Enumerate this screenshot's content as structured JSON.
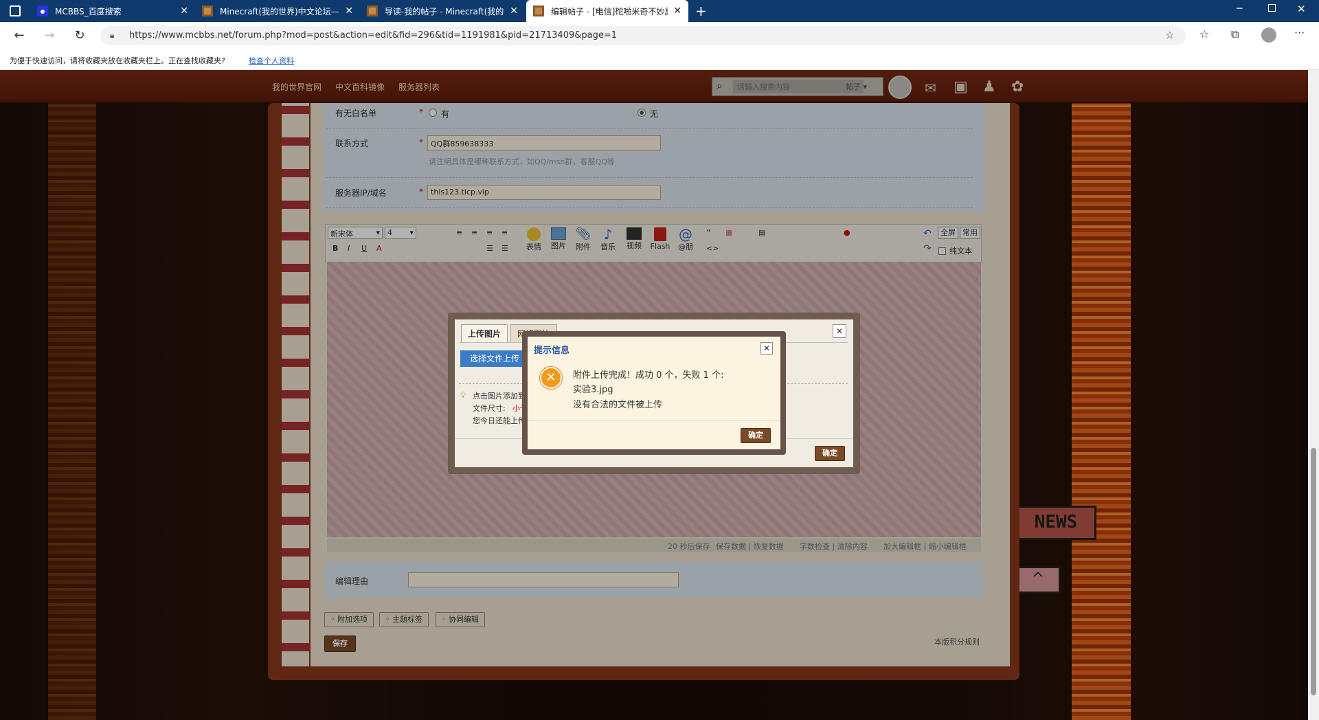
{
  "browser": {
    "tabs": [
      {
        "label": "MCBBS_百度搜索",
        "icon": "baidu-icon"
      },
      {
        "label": "Minecraft(我的世界)中文论坛—",
        "icon": "mcbbs-icon"
      },
      {
        "label": "导读-我的帖子 - Minecraft(我的世",
        "icon": "mcbbs-icon"
      },
      {
        "label": "编辑帖子 - [电信]砣啪米奇不妙屋",
        "icon": "mcbbs-icon"
      }
    ],
    "url": "https://www.mcbbs.net/forum.php?mod=post&action=edit&fid=296&tid=1191981&pid=21713409&page=1",
    "favbar_text": "为便于快速访问，请将收藏夹放在收藏夹栏上。正在查找收藏夹?",
    "favbar_link": "检查个人资料"
  },
  "sitenav": {
    "links": [
      "我的世界官网",
      "中文百科镜像",
      "服务器列表"
    ],
    "search_placeholder": "请输入搜索内容",
    "search_type": "帖子"
  },
  "form": {
    "whitelist_label": "有无白名单",
    "opt_yes": "有",
    "opt_no": "无",
    "contact_label": "联系方式",
    "contact_value": "QQ群859638333",
    "contact_hint": "请注明具体是哪种联系方式，如QQ/msn群，客服QQ等",
    "ip_label": "服务器IP/域名",
    "ip_value": "this123.ticp.vip",
    "required_mark": "*"
  },
  "editor": {
    "font": "新宋体",
    "size": "4",
    "buttons": [
      "表情",
      "图片",
      "附件",
      "音乐",
      "视频",
      "Flash",
      "@朋"
    ],
    "right_buttons": [
      "全屏",
      "常用"
    ],
    "plaintext": "纯文本",
    "status_left": "20 秒后保存",
    "status_links": "保存数据 | 恢复数据",
    "status_right": "字数检查 | 清除内容",
    "status_resize": "加大编辑框 | 缩小编辑框"
  },
  "edit_reason_label": "编辑理由",
  "chips": [
    "附加选项",
    "主题标签",
    "协同编辑"
  ],
  "save_label": "保存",
  "rules_link": "本版积分规则",
  "upload_dialog": {
    "tab1": "上传图片",
    "tab2": "网络图片",
    "choose": "选择文件上传",
    "tip1": "点击图片添加到",
    "tip2": "文件尺寸:",
    "tip2_val": "小于",
    "tip3": "您今日还能上传",
    "ok": "确定"
  },
  "message_dialog": {
    "title": "提示信息",
    "line1": "附件上传完成！成功 0 个，失败 1 个:",
    "line2": "实验3.jpg",
    "line3": "没有合法的文件被上传",
    "ok": "确定"
  },
  "colors": {
    "tabbar": "#0f3a6e",
    "dialog_title": "#2a5ca3",
    "error_orange": "#f29a1a"
  }
}
